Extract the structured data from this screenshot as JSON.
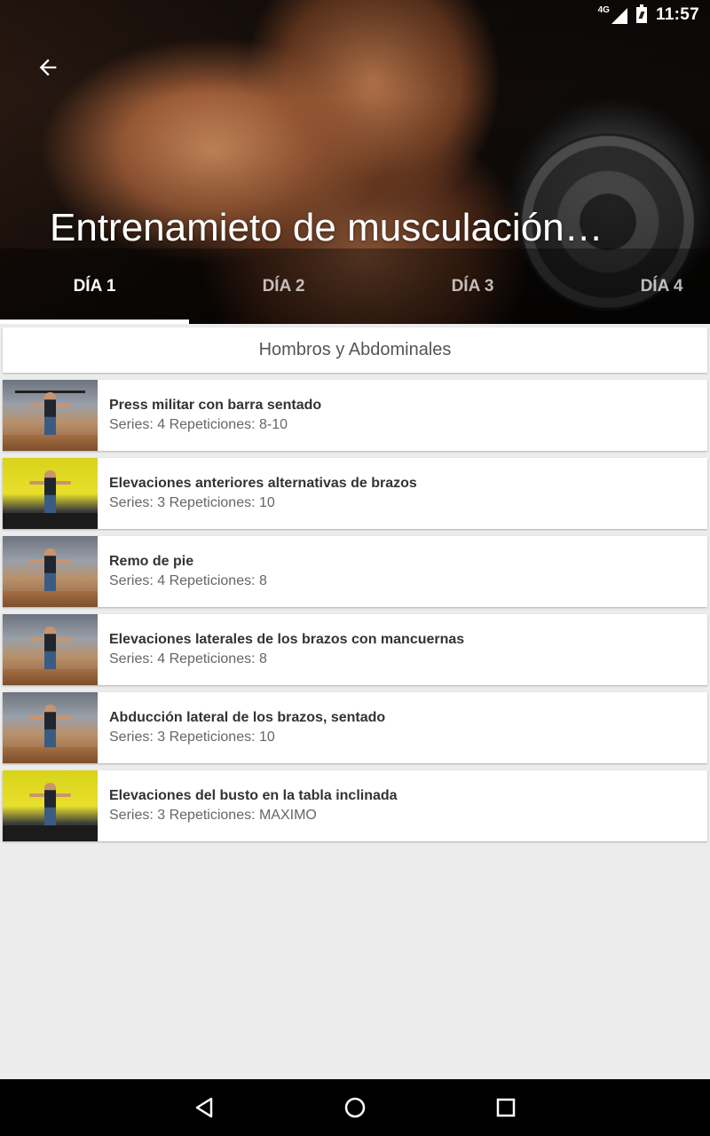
{
  "status_bar": {
    "network": "4G",
    "time": "11:57"
  },
  "header": {
    "title": "Entrenamieto de musculación…",
    "back_icon": "arrow-left-icon"
  },
  "tabs": [
    {
      "label": "DÍA 1",
      "active": true
    },
    {
      "label": "DÍA 2",
      "active": false
    },
    {
      "label": "DÍA 3",
      "active": false
    },
    {
      "label": "DÍA 4",
      "active": false
    }
  ],
  "section": {
    "title": "Hombros y Abdominales"
  },
  "exercises": [
    {
      "title": "Press militar con barra sentado",
      "subtitle": "Series: 4 Repeticiones: 8-10"
    },
    {
      "title": "Elevaciones anteriores alternativas de brazos",
      "subtitle": "Series: 3 Repeticiones: 10"
    },
    {
      "title": "Remo de pie",
      "subtitle": "Series: 4 Repeticiones: 8"
    },
    {
      "title": "Elevaciones laterales de los brazos con mancuernas",
      "subtitle": "Series: 4 Repeticiones: 8"
    },
    {
      "title": "Abducción lateral de los brazos, sentado",
      "subtitle": "Series: 3 Repeticiones: 10"
    },
    {
      "title": "Elevaciones del busto en la tabla inclinada",
      "subtitle": "Series: 3 Repeticiones: MAXIMO"
    }
  ],
  "nav_bar": {
    "back": "nav-back-icon",
    "home": "nav-home-icon",
    "recents": "nav-recents-icon"
  },
  "colors": {
    "background": "#ececec",
    "card": "#ffffff",
    "tab_indicator": "#ffffff",
    "nav_bar": "#000000"
  }
}
